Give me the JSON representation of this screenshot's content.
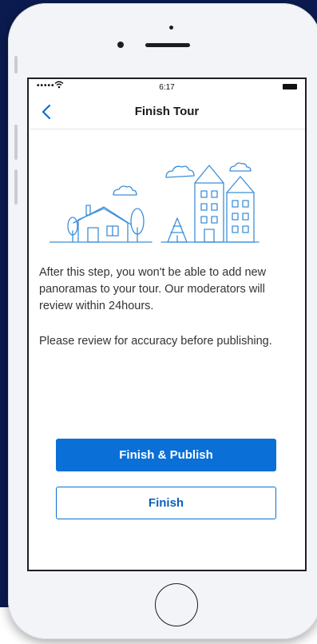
{
  "status_bar": {
    "time": "6:17",
    "signal": "•••••"
  },
  "nav": {
    "back_icon": "chevron-left-icon",
    "title": "Finish Tour"
  },
  "content": {
    "paragraph_1": "After this step, you won't be able to add new panoramas to your tour. Our moderators will review within 24hours.",
    "paragraph_2": "Please review for accuracy before publishing."
  },
  "actions": {
    "primary_label": "Finish & Publish",
    "secondary_label": "Finish"
  },
  "colors": {
    "accent": "#0a6fd6",
    "illustration_stroke": "#3b8fd9",
    "background": "#0b1b4f"
  }
}
